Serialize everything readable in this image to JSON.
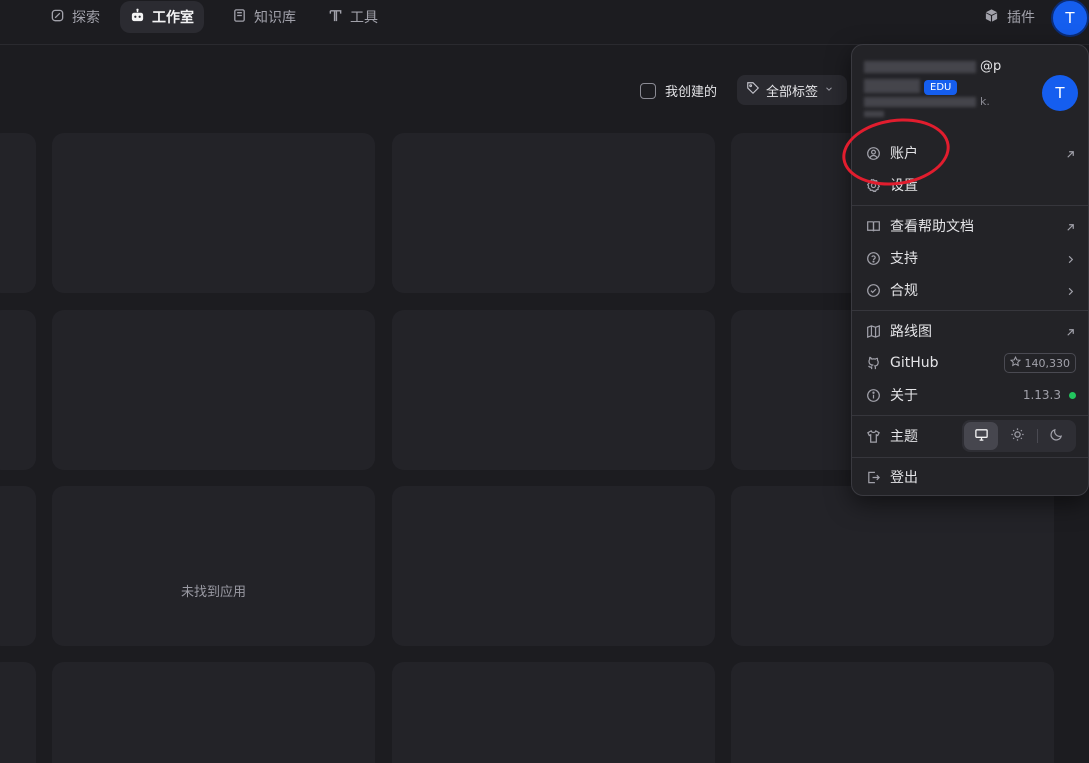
{
  "nav": {
    "explore": "探索",
    "studio": "工作室",
    "knowledge": "知识库",
    "tools": "工具",
    "plugins": "插件",
    "avatar_initial": "T"
  },
  "filters": {
    "created_by_me": "我创建的",
    "all_tags": "全部标签"
  },
  "content": {
    "empty_message": "未找到应用"
  },
  "account_menu": {
    "user_name_visible": "@p",
    "badge": "EDU",
    "email_visible": "k.",
    "avatar_initial": "T",
    "items": {
      "account": "账户",
      "settings": "设置",
      "help_docs": "查看帮助文档",
      "support": "支持",
      "compliance": "合规",
      "roadmap": "路线图",
      "github": "GitHub",
      "github_stars": "140,330",
      "about": "关于",
      "version": "1.13.3",
      "theme": "主题",
      "logout": "登出"
    }
  },
  "colors": {
    "accent": "#155eef",
    "annotation": "#e11d2e",
    "status_ok": "#22c55e"
  }
}
